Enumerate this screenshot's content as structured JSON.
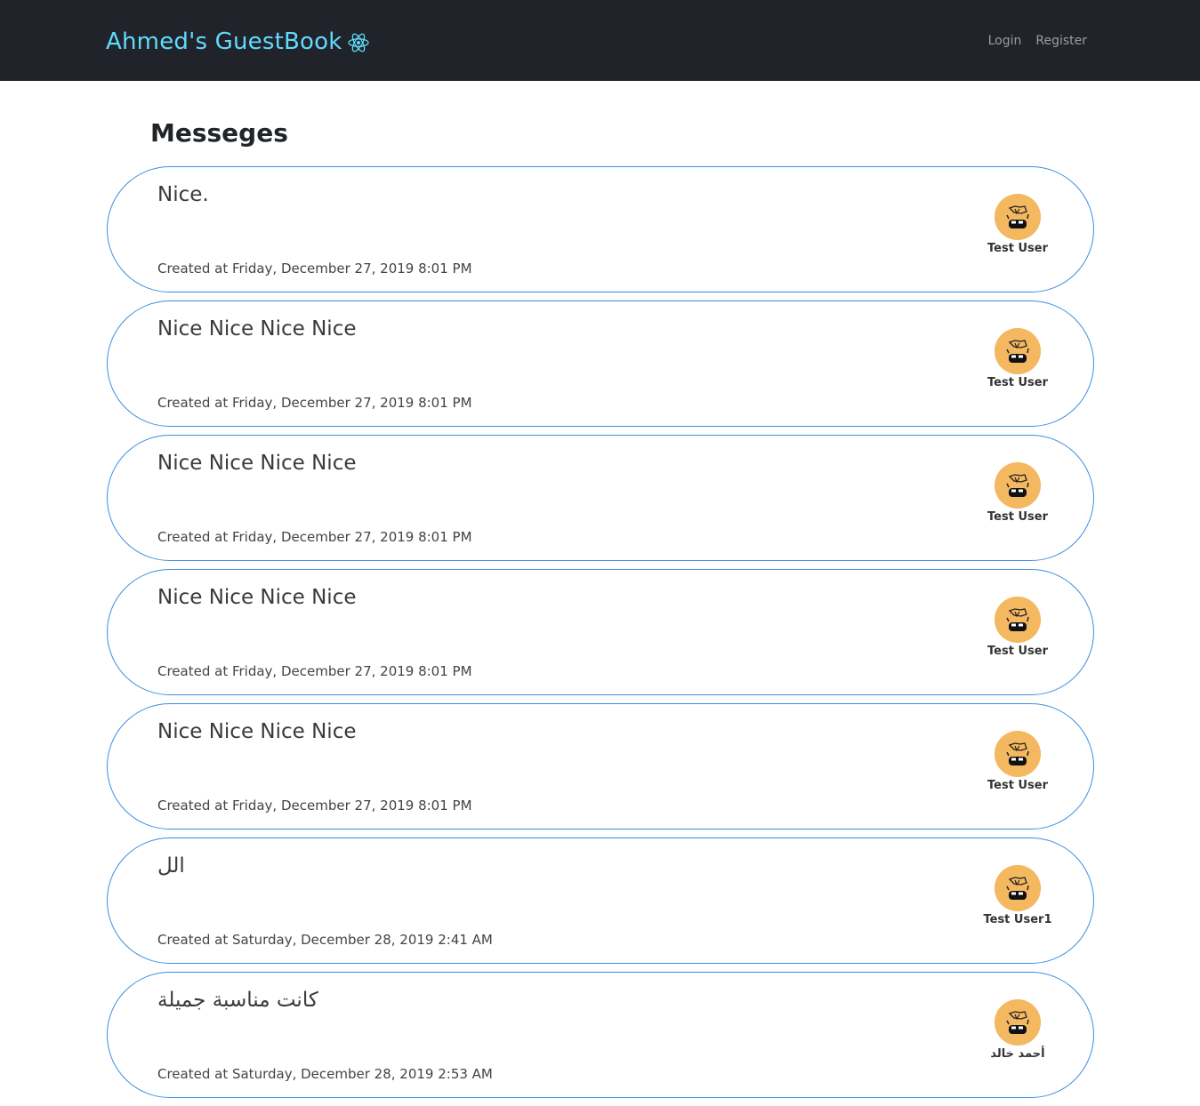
{
  "navbar": {
    "brand": "Ahmed's GuestBook",
    "brand_icon": "react-atom-icon",
    "links": [
      "Login",
      "Register"
    ]
  },
  "page": {
    "title": "Messeges"
  },
  "colors": {
    "navbar_bg": "#20232a",
    "brand": "#61dafb",
    "card_border": "#3d8fe0",
    "avatar_bg": "#f4b860"
  },
  "messages": [
    {
      "text": "Nice.",
      "created": "Created at Friday, December 27, 2019 8:01 PM",
      "author": "Test User"
    },
    {
      "text": "Nice Nice Nice Nice",
      "created": "Created at Friday, December 27, 2019 8:01 PM",
      "author": "Test User"
    },
    {
      "text": "Nice Nice Nice Nice",
      "created": "Created at Friday, December 27, 2019 8:01 PM",
      "author": "Test User"
    },
    {
      "text": "Nice Nice Nice Nice",
      "created": "Created at Friday, December 27, 2019 8:01 PM",
      "author": "Test User"
    },
    {
      "text": "Nice Nice Nice Nice",
      "created": "Created at Friday, December 27, 2019 8:01 PM",
      "author": "Test User"
    },
    {
      "text": "الل",
      "created": "Created at Saturday, December 28, 2019 2:41 AM",
      "author": "Test User1"
    },
    {
      "text": "كانت مناسبة جميلة",
      "created": "Created at Saturday, December 28, 2019 2:53 AM",
      "author": "أحمد خالد"
    }
  ]
}
